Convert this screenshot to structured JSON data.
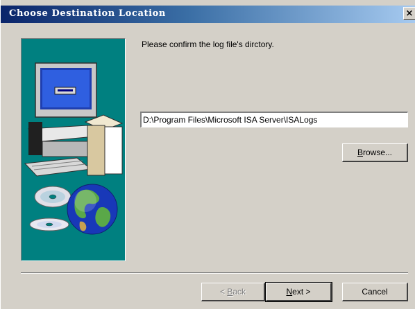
{
  "window": {
    "title": "Choose Destination Location",
    "close_glyph": "×"
  },
  "main": {
    "prompt": "Please confirm the log file's dirctory.",
    "path_value": "D:\\Program Files\\Microsoft ISA Server\\ISALogs"
  },
  "buttons": {
    "browse": {
      "pre": "",
      "key": "B",
      "post": "rowse..."
    },
    "back": {
      "pre": "< ",
      "key": "B",
      "post": "ack"
    },
    "next": {
      "pre": "",
      "key": "N",
      "post": "ext >"
    },
    "cancel": "Cancel"
  },
  "icons": {
    "artwork": [
      "computer-icon",
      "cd-disc-icon",
      "globe-icon"
    ]
  },
  "colors": {
    "title_start": "#0a246a",
    "title_end": "#a6caf0",
    "panel": "#008080",
    "face": "#d4d0c8"
  }
}
